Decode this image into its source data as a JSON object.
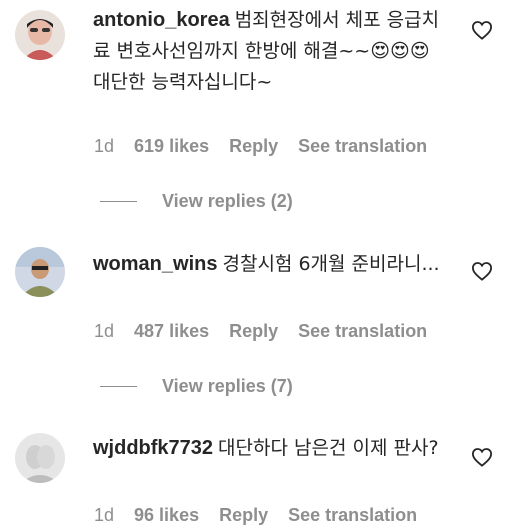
{
  "comments": [
    {
      "username": "antonio_korea",
      "text": "범죄현장에서 체포 응급치료 변호사선임까지 한방에 해결~~😍😍😍 대단한 능력자십니다~",
      "time": "1d",
      "likes": "619 likes",
      "reply_label": "Reply",
      "translate_label": "See translation",
      "view_replies": "View replies (2)"
    },
    {
      "username": "woman_wins",
      "text": "경찰시험 6개월 준비라니...",
      "time": "1d",
      "likes": "487 likes",
      "reply_label": "Reply",
      "translate_label": "See translation",
      "view_replies": "View replies (7)"
    },
    {
      "username": "wjddbfk7732",
      "text": "대단하다 남은건 이제 판사?",
      "time": "1d",
      "likes": "96 likes",
      "reply_label": "Reply",
      "translate_label": "See translation"
    }
  ],
  "icons": {
    "like": "heart-outline-icon"
  },
  "colors": {
    "username": "#262626",
    "meta": "#8e8e8e"
  }
}
